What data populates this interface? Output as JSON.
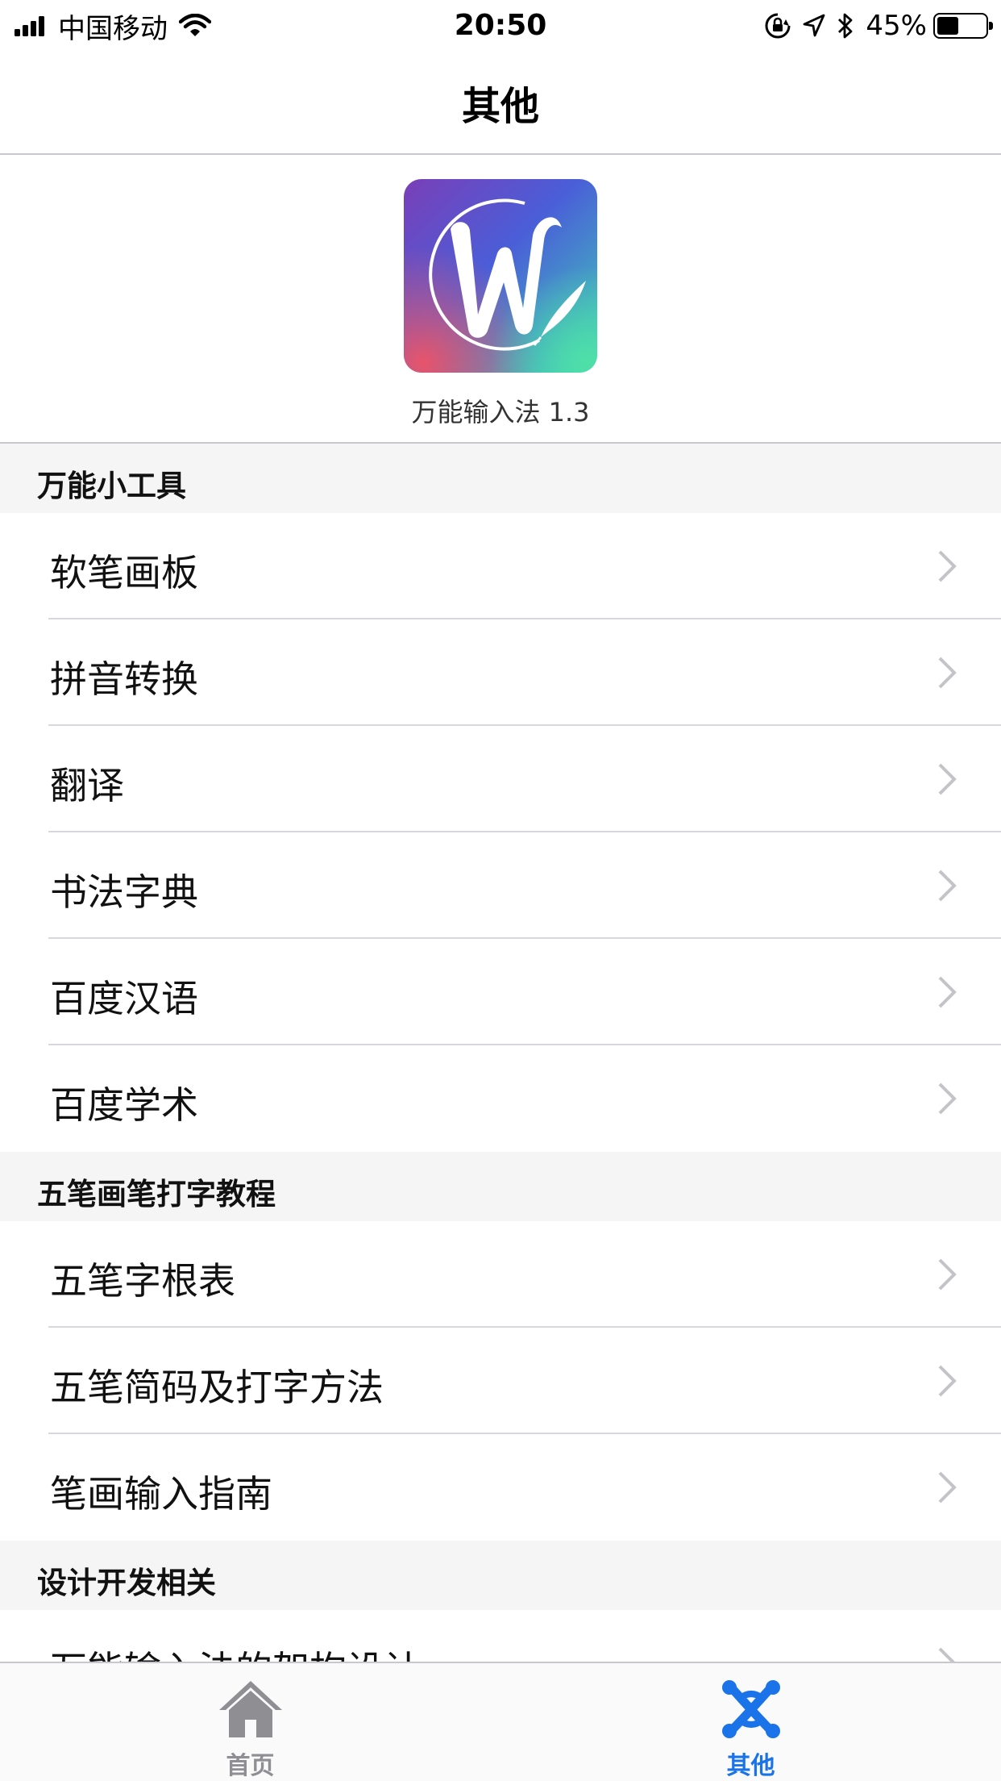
{
  "status_bar": {
    "carrier": "中国移动",
    "time": "20:50",
    "battery_percent": "45%",
    "battery_level": 0.45,
    "icons": [
      "signal-icon",
      "wifi-icon",
      "orientation-lock-icon",
      "location-icon",
      "bluetooth-icon",
      "battery-icon"
    ]
  },
  "nav": {
    "title": "其他"
  },
  "app": {
    "version_label": "万能输入法 1.3"
  },
  "sections": [
    {
      "header": "万能小工具",
      "items": [
        "软笔画板",
        "拼音转换",
        "翻译",
        "书法字典",
        "百度汉语",
        "百度学术"
      ]
    },
    {
      "header": "五笔画笔打字教程",
      "items": [
        "五笔字根表",
        "五笔简码及打字方法",
        "笔画输入指南"
      ]
    },
    {
      "header": "设计开发相关",
      "items": [
        "万能输入法的架构设计"
      ]
    }
  ],
  "tabs": [
    {
      "label": "首页",
      "icon": "home-icon",
      "active": false
    },
    {
      "label": "其他",
      "icon": "other-icon",
      "active": true
    }
  ],
  "colors": {
    "active_tab": "#1a73e8",
    "inactive_tab": "#8e8e93",
    "section_bg": "#f5f5f6"
  }
}
